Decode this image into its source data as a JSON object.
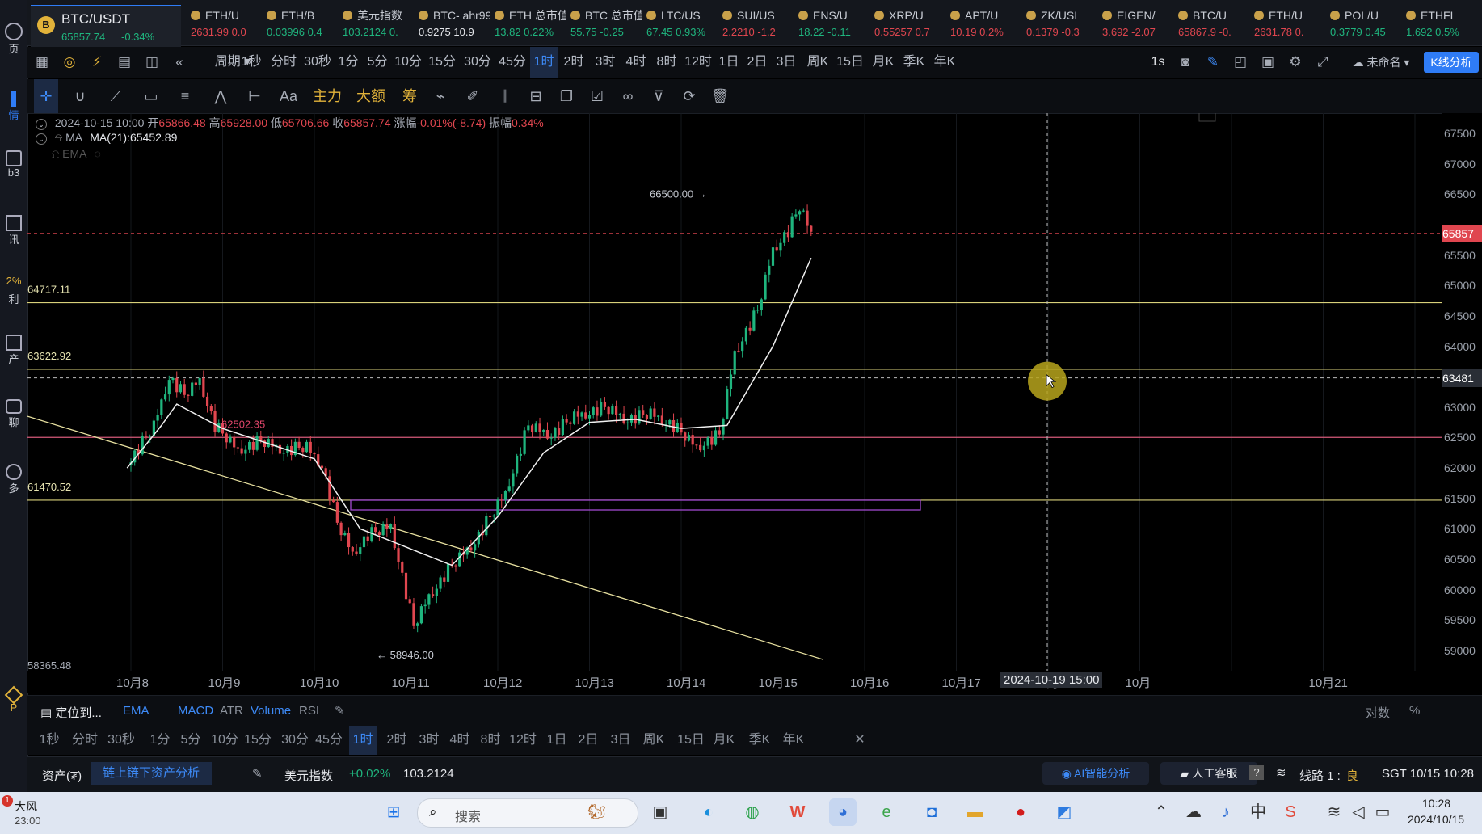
{
  "leftbar": {
    "items": [
      {
        "label": "页",
        "icon": "home-icon"
      },
      {
        "label": "情",
        "icon": "market-icon"
      },
      {
        "label": "b3",
        "icon": "web3-icon"
      },
      {
        "label": "讯",
        "icon": "news-icon"
      },
      {
        "label": "2%",
        "icon": "percent-icon"
      },
      {
        "label": "利",
        "icon": "profit-icon"
      },
      {
        "label": "产",
        "icon": "asset-icon"
      },
      {
        "label": "聊",
        "icon": "chat-icon"
      },
      {
        "label": "多",
        "icon": "more-icon"
      },
      {
        "label": "P",
        "icon": "vip-icon"
      }
    ]
  },
  "tickers": {
    "main": {
      "name": "BTC/USDT",
      "price": "65857.74",
      "change": "-0.34%"
    },
    "items": [
      {
        "name": "ETH/U",
        "price": "2631.99",
        "change": "0.0",
        "color": "red"
      },
      {
        "name": "ETH/B",
        "price": "0.03996",
        "change": "0.4",
        "color": "green"
      },
      {
        "name": "美元指数",
        "price": "103.2124",
        "change": "0.",
        "color": "green"
      },
      {
        "name": "BTC- ahr99",
        "price": "0.9275",
        "change": "10.9",
        "color": "white"
      },
      {
        "name": "ETH 总市值",
        "price": "13.82",
        "change": "0.22%",
        "color": "green"
      },
      {
        "name": "BTC 总市值",
        "price": "55.75",
        "change": "-0.25",
        "color": "green"
      },
      {
        "name": "LTC/US",
        "price": "67.45",
        "change": "0.93%",
        "color": "green"
      },
      {
        "name": "SUI/US",
        "price": "2.2210",
        "change": "-1.2",
        "color": "red"
      },
      {
        "name": "ENS/U",
        "price": "18.22",
        "change": "-0.11",
        "color": "green"
      },
      {
        "name": "XRP/U",
        "price": "0.55257",
        "change": "0.7",
        "color": "red"
      },
      {
        "name": "APT/U",
        "price": "10.19",
        "change": "0.2%",
        "color": "red"
      },
      {
        "name": "ZK/USI",
        "price": "0.1379",
        "change": "-0.3",
        "color": "red"
      },
      {
        "name": "EIGEN/",
        "price": "3.692",
        "change": "-2.07",
        "color": "red"
      },
      {
        "name": "BTC/U",
        "price": "65867.9",
        "change": "-0.",
        "color": "red"
      },
      {
        "name": "ETH/U",
        "price": "2631.78",
        "change": "0.",
        "color": "red"
      },
      {
        "name": "POL/U",
        "price": "0.3779",
        "change": "0.45",
        "color": "green"
      },
      {
        "name": "ETHFI",
        "price": "1.692",
        "change": "0.5%",
        "color": "green"
      }
    ]
  },
  "periodbar": {
    "cycle_label": "周期",
    "periods": [
      "1秒",
      "分时",
      "30秒",
      "1分",
      "5分",
      "10分",
      "15分",
      "30分",
      "45分",
      "1时",
      "2时",
      "3时",
      "4时",
      "8时",
      "12时",
      "1日",
      "2日",
      "3日",
      "周K",
      "15日",
      "月K",
      "季K",
      "年K"
    ],
    "active": "1时",
    "right_label": "1s",
    "layout_name": "未命名",
    "analysis_button": "K线分析"
  },
  "drawbar": {
    "text_tool": "Aa",
    "gold_tools": [
      "主力",
      "大额",
      "筹"
    ]
  },
  "info": {
    "date": "2024-10-15 10:00",
    "open_label": "开",
    "open": "65866.48",
    "high_label": "高",
    "high": "65928.00",
    "low_label": "低",
    "low": "65706.66",
    "close_label": "收",
    "close": "65857.74",
    "chg_label": "涨幅",
    "chg": "-0.01%(-8.74)",
    "amp_label": "振幅",
    "amp": "0.34%",
    "ma_label": "MA",
    "ma_value": "MA(21):65452.89",
    "ema_label": "EMA"
  },
  "chart_annotations": {
    "level_64717": "64717.11",
    "level_63622": "63622.92",
    "level_62502": "62502.35",
    "level_61470": "61470.52",
    "level_58365": "58365.48",
    "high_label": "66500.00 →",
    "low_label": "← 58946.00",
    "crosshair_date": "2024-10-19 15:00"
  },
  "chart_data": {
    "type": "candlestick",
    "title": "BTC/USDT",
    "interval": "1时",
    "x_ticks": [
      "10月8",
      "10月9",
      "10月10",
      "10月11",
      "10月12",
      "10月13",
      "10月14",
      "10月15",
      "10月16",
      "10月17",
      "10月18",
      "10月",
      "10月21"
    ],
    "y_ticks": [
      "67500",
      "67000",
      "66500",
      "65500",
      "65000",
      "64500",
      "64000",
      "63000",
      "62500",
      "62000",
      "61500",
      "61000",
      "60500",
      "60000",
      "59500",
      "59000"
    ],
    "ylim": [
      58800,
      67700
    ],
    "current_price_tag": "65857",
    "cursor_price_tag": "63481",
    "close_path": [
      [
        "10-07 23:00",
        62050
      ],
      [
        "10-08 06:00",
        62700
      ],
      [
        "10-08 10:00",
        63500
      ],
      [
        "10-08 14:00",
        63200
      ],
      [
        "10-08 18:00",
        63450
      ],
      [
        "10-08 22:00",
        62700
      ],
      [
        "10-09 04:00",
        62300
      ],
      [
        "10-09 10:00",
        62450
      ],
      [
        "10-09 16:00",
        62300
      ],
      [
        "10-09 22:00",
        62350
      ],
      [
        "10-10 02:00",
        62050
      ],
      [
        "10-10 06:00",
        61100
      ],
      [
        "10-10 10:00",
        60600
      ],
      [
        "10-10 14:00",
        60900
      ],
      [
        "10-10 20:00",
        61050
      ],
      [
        "10-11 02:00",
        59400
      ],
      [
        "10-11 06:00",
        59900
      ],
      [
        "10-11 12:00",
        60400
      ],
      [
        "10-11 18:00",
        60800
      ],
      [
        "10-12 02:00",
        61600
      ],
      [
        "10-12 08:00",
        62700
      ],
      [
        "10-12 14:00",
        62550
      ],
      [
        "10-12 20:00",
        62850
      ],
      [
        "10-13 04:00",
        63000
      ],
      [
        "10-13 10:00",
        62800
      ],
      [
        "10-13 16:00",
        62900
      ],
      [
        "10-13 22:00",
        62700
      ],
      [
        "10-14 04:00",
        62350
      ],
      [
        "10-14 10:00",
        62550
      ],
      [
        "10-14 14:00",
        63900
      ],
      [
        "10-14 20:00",
        64600
      ],
      [
        "10-15 00:00",
        65600
      ],
      [
        "10-15 04:00",
        65900
      ],
      [
        "10-15 07:00",
        66300
      ],
      [
        "10-15 10:00",
        65857
      ]
    ],
    "ma21_path": [
      [
        "10-07 23:00",
        62000
      ],
      [
        "10-08 08:00",
        62700
      ],
      [
        "10-08 12:00",
        63050
      ],
      [
        "10-09 00:00",
        62650
      ],
      [
        "10-09 12:00",
        62400
      ],
      [
        "10-10 00:00",
        62150
      ],
      [
        "10-10 12:00",
        61000
      ],
      [
        "10-11 00:00",
        60700
      ],
      [
        "10-11 12:00",
        60400
      ],
      [
        "10-12 00:00",
        61200
      ],
      [
        "10-12 12:00",
        62250
      ],
      [
        "10-13 00:00",
        62750
      ],
      [
        "10-13 12:00",
        62800
      ],
      [
        "10-14 00:00",
        62650
      ],
      [
        "10-14 12:00",
        62700
      ],
      [
        "10-15 00:00",
        64000
      ],
      [
        "10-15 10:00",
        65452
      ]
    ],
    "levels": [
      64717.11,
      63622.92,
      62502.35,
      61470.52
    ],
    "high": 66500.0,
    "low": 58946.0
  },
  "indbar": {
    "locate": "定位到...",
    "indicators": [
      "EMA",
      "MACD",
      "ATR",
      "Volume",
      "RSI"
    ],
    "right": [
      "对数",
      "%"
    ]
  },
  "periodbar2": {
    "periods": [
      "1秒",
      "分时",
      "30秒",
      "1分",
      "5分",
      "10分",
      "15分",
      "30分",
      "45分",
      "1时",
      "2时",
      "3时",
      "4时",
      "8时",
      "12时",
      "1日",
      "2日",
      "3日",
      "周K",
      "15日",
      "月K",
      "季K",
      "年K"
    ],
    "active": "1时"
  },
  "statusbar": {
    "assets": "资产(₮)",
    "asset_analysis": "链上链下资产分析",
    "index_name": "美元指数",
    "index_change": "+0.02%",
    "index_value": "103.2124",
    "ai": "AI智能分析",
    "service": "人工客服",
    "line": "线路 1 :",
    "line_quality": "良",
    "clock": "SGT 10/15 10:28"
  },
  "taskbar": {
    "weather_title": "大风",
    "weather_time": "23:00",
    "badge": "1",
    "search_placeholder": "搜索",
    "time": "10:28",
    "date": "2024/10/15"
  }
}
